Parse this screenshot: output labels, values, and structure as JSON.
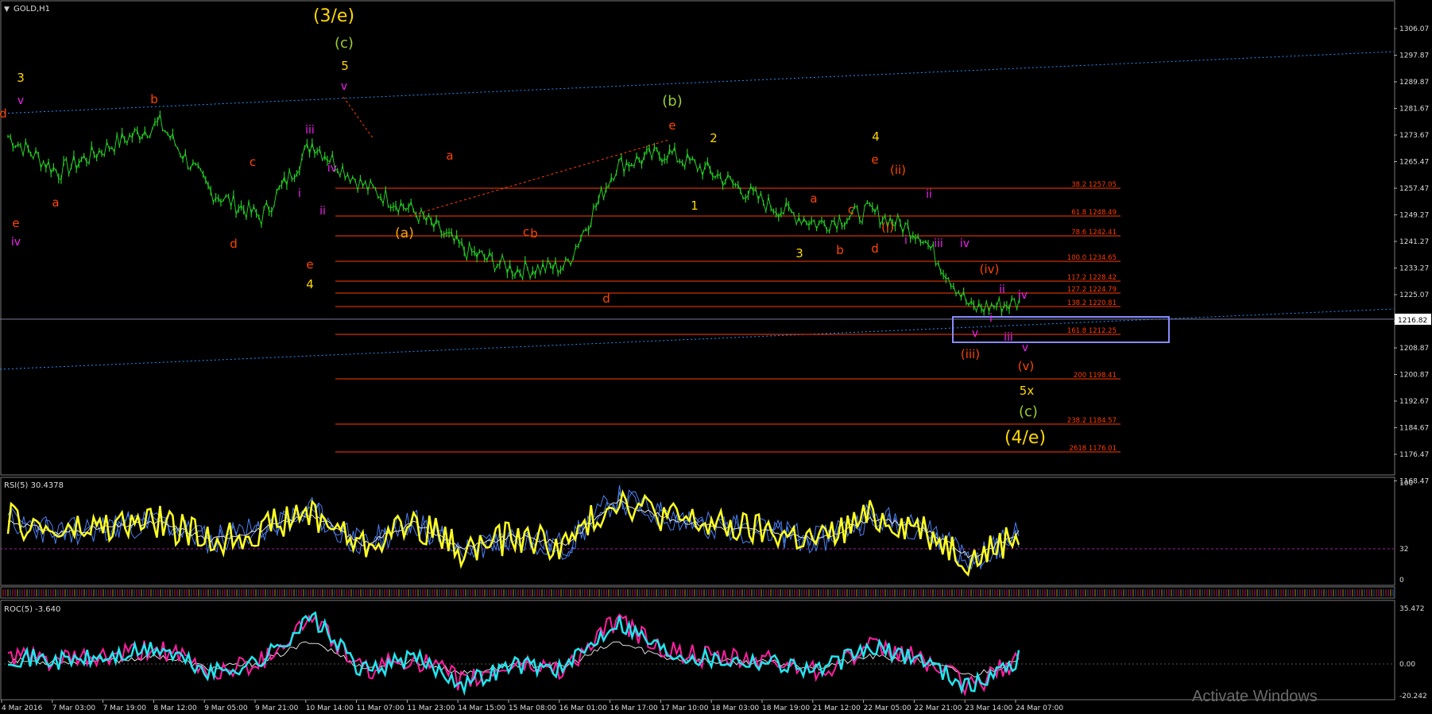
{
  "symbol_label": "GOLD,H1",
  "watermark": "Activate Windows",
  "colors": {
    "price_bar": "#22cc22",
    "fib_line": "#ff3c00",
    "channel": "#1e90ff",
    "box": "#8a8aff",
    "current_price": "#7a7aa0",
    "rsi_main": "#ffff22",
    "rsi_extra": "#4a7ff0",
    "roc_main": "#22e5ee",
    "roc_second": "#ff1fa0"
  },
  "price_axis_ticks": [
    "1306.07",
    "1297.87",
    "1289.87",
    "1281.67",
    "1273.67",
    "1265.47",
    "1257.47",
    "1249.27",
    "1241.27",
    "1233.27",
    "1225.07",
    "1216.82",
    "1208.87",
    "1200.87",
    "1192.67",
    "1184.67",
    "1176.47",
    "1168.47"
  ],
  "current_price_label": "1216.82",
  "time_axis_ticks": [
    "4 Mar 2016",
    "7 Mar 03:00",
    "7 Mar 19:00",
    "8 Mar 12:00",
    "9 Mar 05:00",
    "9 Mar 21:00",
    "10 Mar 14:00",
    "11 Mar 07:00",
    "11 Mar 23:00",
    "14 Mar 15:00",
    "15 Mar 08:00",
    "16 Mar 01:00",
    "16 Mar 17:00",
    "17 Mar 10:00",
    "18 Mar 03:00",
    "18 Mar 19:00",
    "21 Mar 12:00",
    "22 Mar 05:00",
    "22 Mar 21:00",
    "23 Mar 14:00",
    "24 Mar 07:00"
  ],
  "fib_levels": [
    {
      "label": "38.2 1257.05",
      "price": 1257.05
    },
    {
      "label": "61.8 1248.49",
      "price": 1248.49
    },
    {
      "label": "78.6 1242.41",
      "price": 1242.41
    },
    {
      "label": "100.0 1234.65",
      "price": 1234.65
    },
    {
      "label": "117.2 1228.42",
      "price": 1228.42
    },
    {
      "label": "127.2 1224.79",
      "price": 1224.79
    },
    {
      "label": "138.2 1220.81",
      "price": 1220.81
    },
    {
      "label": "161.8 1212.25",
      "price": 1212.25
    },
    {
      "label": "200 1198.41",
      "price": 1198.41
    },
    {
      "label": "238.2 1184.57",
      "price": 1184.57
    },
    {
      "label": "2618 1176.01",
      "price": 1176.01
    }
  ],
  "wave_labels": [
    {
      "text": "(3/e)",
      "color": "#ffd700",
      "size": 22
    },
    {
      "text": "(c)",
      "color": "#9acd32",
      "size": 18
    },
    {
      "text": "5",
      "color": "#ffd700",
      "size": 15
    },
    {
      "text": "v",
      "color": "#ee22ee",
      "size": 14
    },
    {
      "text": "3",
      "color": "#ffd700",
      "size": 15
    },
    {
      "text": "v",
      "color": "#ee22ee",
      "size": 14
    },
    {
      "text": "d",
      "color": "#ff4500",
      "size": 15
    },
    {
      "text": "e",
      "color": "#ff4500",
      "size": 15
    },
    {
      "text": "iv",
      "color": "#ee22ee",
      "size": 14
    },
    {
      "text": "a",
      "color": "#ff4500",
      "size": 15
    },
    {
      "text": "b",
      "color": "#ff4500",
      "size": 15
    },
    {
      "text": "c",
      "color": "#ff4500",
      "size": 15
    },
    {
      "text": "d",
      "color": "#ff4500",
      "size": 15
    },
    {
      "text": "i",
      "color": "#ee22ee",
      "size": 14
    },
    {
      "text": "ii",
      "color": "#ee22ee",
      "size": 14
    },
    {
      "text": "iii",
      "color": "#ee22ee",
      "size": 14
    },
    {
      "text": "iv",
      "color": "#ee22ee",
      "size": 14
    },
    {
      "text": "e",
      "color": "#ff4500",
      "size": 15
    },
    {
      "text": "4",
      "color": "#ffd700",
      "size": 15
    },
    {
      "text": "(a)",
      "color": "#ffa500",
      "size": 17
    },
    {
      "text": "a",
      "color": "#ff4500",
      "size": 15
    },
    {
      "text": "b",
      "color": "#ff4500",
      "size": 15
    },
    {
      "text": "c",
      "color": "#ff4500",
      "size": 15
    },
    {
      "text": "d",
      "color": "#ff4500",
      "size": 15
    },
    {
      "text": "(b)",
      "color": "#9acd32",
      "size": 18
    },
    {
      "text": "e",
      "color": "#ff4500",
      "size": 15
    },
    {
      "text": "1",
      "color": "#ffd700",
      "size": 15
    },
    {
      "text": "2",
      "color": "#ffd700",
      "size": 15
    },
    {
      "text": "3",
      "color": "#ffd700",
      "size": 15
    },
    {
      "text": "a",
      "color": "#ff4500",
      "size": 15
    },
    {
      "text": "b",
      "color": "#ff4500",
      "size": 15
    },
    {
      "text": "c",
      "color": "#ff4500",
      "size": 15
    },
    {
      "text": "d",
      "color": "#ff4500",
      "size": 15
    },
    {
      "text": "4",
      "color": "#ffd700",
      "size": 15
    },
    {
      "text": "e",
      "color": "#ff4500",
      "size": 15
    },
    {
      "text": "(ii)",
      "color": "#ff4500",
      "size": 15
    },
    {
      "text": "(i)",
      "color": "#ff4500",
      "size": 15
    },
    {
      "text": "i",
      "color": "#ee22ee",
      "size": 14
    },
    {
      "text": "ii",
      "color": "#ee22ee",
      "size": 14
    },
    {
      "text": "iii",
      "color": "#ee22ee",
      "size": 14
    },
    {
      "text": "iv",
      "color": "#ee22ee",
      "size": 14
    },
    {
      "text": "(iv)",
      "color": "#ff4500",
      "size": 15
    },
    {
      "text": "v",
      "color": "#ee22ee",
      "size": 14
    },
    {
      "text": "i",
      "color": "#ee22ee",
      "size": 14
    },
    {
      "text": "(iii)",
      "color": "#ff4500",
      "size": 15
    },
    {
      "text": "ii",
      "color": "#ee22ee",
      "size": 14
    },
    {
      "text": "iv",
      "color": "#ee22ee",
      "size": 14
    },
    {
      "text": "iii",
      "color": "#ee22ee",
      "size": 14
    },
    {
      "text": "v",
      "color": "#ee22ee",
      "size": 14
    },
    {
      "text": "(v)",
      "color": "#ff4500",
      "size": 15
    },
    {
      "text": "5x",
      "color": "#ffd700",
      "size": 15
    },
    {
      "text": "(c)",
      "color": "#9acd32",
      "size": 18
    },
    {
      "text": "(4/e)",
      "color": "#ffd700",
      "size": 22
    }
  ],
  "rsi_panel": {
    "label": "RSI(5) 30.4378",
    "ticks": [
      "100",
      "32",
      "0"
    ],
    "level": 32
  },
  "roc_panel": {
    "label": "ROC(5) -3.640",
    "ticks": [
      "35.472",
      "0.00",
      "-20.242"
    ]
  },
  "chart_data": {
    "type": "line",
    "title": "GOLD,H1",
    "xlabel": "",
    "ylabel": "",
    "ylim": [
      1166.5,
      1311
    ],
    "x": [
      "4 Mar 2016",
      "7 Mar 03:00",
      "7 Mar 19:00",
      "8 Mar 12:00",
      "9 Mar 05:00",
      "9 Mar 21:00",
      "10 Mar 14:00",
      "11 Mar 07:00",
      "11 Mar 23:00",
      "14 Mar 15:00",
      "15 Mar 08:00",
      "16 Mar 01:00",
      "16 Mar 17:00",
      "17 Mar 10:00",
      "18 Mar 03:00",
      "18 Mar 19:00",
      "21 Mar 12:00",
      "22 Mar 05:00",
      "22 Mar 21:00",
      "23 Mar 14:00",
      "24 Mar 07:00"
    ],
    "series": [
      {
        "name": "GOLD,H1",
        "values": [
          1273,
          1262,
          1270,
          1277,
          1256,
          1248,
          1271,
          1258,
          1250,
          1238,
          1232,
          1233,
          1264,
          1268,
          1261,
          1252,
          1246,
          1250,
          1243,
          1220,
          1222
        ]
      },
      {
        "name": "RSI(5) 30.4378",
        "values": [
          62,
          48,
          55,
          60,
          40,
          52,
          70,
          35,
          60,
          30,
          45,
          35,
          85,
          65,
          55,
          50,
          40,
          65,
          55,
          20,
          50
        ]
      },
      {
        "name": "ROC(5) -3.640",
        "values": [
          5,
          2,
          4,
          10,
          -6,
          2,
          30,
          -5,
          4,
          -12,
          0,
          -3,
          28,
          8,
          3,
          2,
          -4,
          10,
          4,
          -15,
          5
        ]
      }
    ],
    "grid": false
  }
}
